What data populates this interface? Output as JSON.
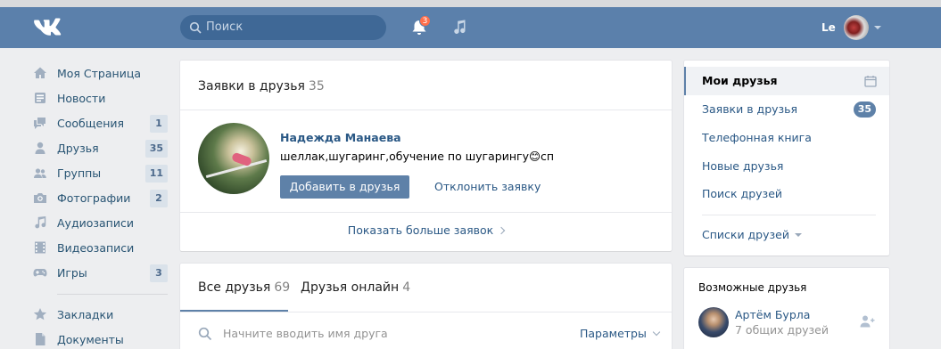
{
  "header": {
    "search_placeholder": "Поиск",
    "notifications_count": "3",
    "user_name": "Le"
  },
  "nav": {
    "items": [
      {
        "label": "Моя Страница",
        "icon": "home-icon",
        "count": ""
      },
      {
        "label": "Новости",
        "icon": "news-icon",
        "count": ""
      },
      {
        "label": "Сообщения",
        "icon": "messages-icon",
        "count": "1"
      },
      {
        "label": "Друзья",
        "icon": "friends-icon",
        "count": "35"
      },
      {
        "label": "Группы",
        "icon": "groups-icon",
        "count": "11"
      },
      {
        "label": "Фотографии",
        "icon": "camera-icon",
        "count": "2"
      },
      {
        "label": "Аудиозаписи",
        "icon": "music-icon",
        "count": ""
      },
      {
        "label": "Видеозаписи",
        "icon": "video-icon",
        "count": ""
      },
      {
        "label": "Игры",
        "icon": "gamepad-icon",
        "count": "3"
      }
    ],
    "secondary": [
      {
        "label": "Закладки",
        "icon": "star-icon"
      },
      {
        "label": "Документы",
        "icon": "document-icon"
      }
    ]
  },
  "requests": {
    "title": "Заявки в друзья",
    "count": "35",
    "person": {
      "name": "Надежда Манаева",
      "description": "шеллак,шугаринг,обучение по шугарингу😊сп"
    },
    "add_label": "Добавить в друзья",
    "reject_label": "Отклонить заявку",
    "show_more_label": "Показать больше заявок"
  },
  "friends": {
    "tabs": [
      {
        "label": "Все друзья",
        "count": "69"
      },
      {
        "label": "Друзья онлайн",
        "count": "4"
      }
    ],
    "search_placeholder": "Начните вводить имя друга",
    "params_label": "Параметры"
  },
  "right_menu": {
    "items": [
      {
        "label": "Мои друзья"
      },
      {
        "label": "Заявки в друзья",
        "count": "35"
      },
      {
        "label": "Телефонная книга"
      },
      {
        "label": "Новые друзья"
      },
      {
        "label": "Поиск друзей"
      }
    ],
    "lists_label": "Списки друзей"
  },
  "possible_friends": {
    "title": "Возможные друзья",
    "person": {
      "name": "Артём Бурла",
      "mutual": "7 общих друзей"
    }
  },
  "colors": {
    "header_bg": "#5b80ab",
    "accent": "#5e81a8",
    "link": "#2a5885",
    "badge": "#ff6f4b",
    "page_bg": "#edeef0"
  }
}
